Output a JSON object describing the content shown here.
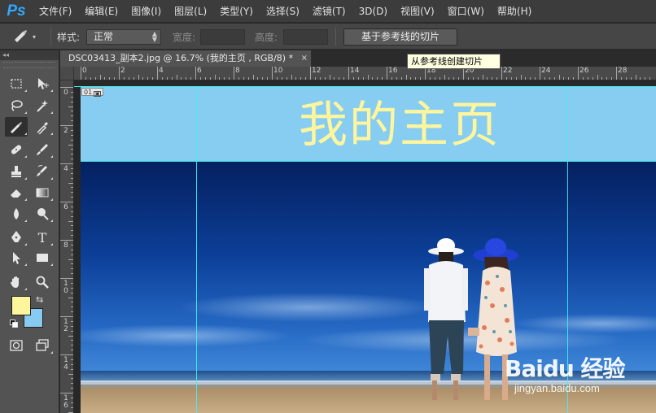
{
  "app": {
    "logo": "Ps"
  },
  "menu": [
    "文件(F)",
    "编辑(E)",
    "图像(I)",
    "图层(L)",
    "类型(Y)",
    "选择(S)",
    "滤镜(T)",
    "3D(D)",
    "视图(V)",
    "窗口(W)",
    "帮助(H)"
  ],
  "options": {
    "style_label": "样式:",
    "style_value": "正常",
    "width_label": "宽度:",
    "width_value": "",
    "height_label": "高度:",
    "height_value": "",
    "slice_button": "基于参考线的切片"
  },
  "tooltip": "从参考线创建切片",
  "document": {
    "tab_title": "DSC03413_副本2.jpg @ 16.7% (我的主页 , RGB/8) *",
    "close_glyph": "×"
  },
  "ruler": {
    "h_labels": [
      "0",
      "2",
      "4",
      "6",
      "8",
      "10",
      "12",
      "14",
      "16",
      "18",
      "20",
      "22",
      "24",
      "26",
      "28"
    ],
    "v_labels": [
      "0",
      "2",
      "4",
      "6",
      "8",
      "1\n0",
      "1\n2",
      "1\n4",
      "1\n6"
    ]
  },
  "canvas": {
    "banner_text": "我的主页",
    "slice_number": "01",
    "banner_color": "#87cdf2",
    "banner_text_color": "#fff59d"
  },
  "colors": {
    "foreground": "#fff59d",
    "background": "#87cbf0",
    "guide": "#3ff2f2",
    "ps_blue": "#31a8ff"
  },
  "tools": [
    "rectangular-marquee-icon",
    "move-icon",
    "lasso-icon",
    "magic-wand-icon",
    "slice-icon",
    "eyedropper-icon",
    "healing-brush-icon",
    "brush-icon",
    "clone-stamp-icon",
    "history-brush-icon",
    "eraser-icon",
    "gradient-icon",
    "blur-icon",
    "dodge-icon",
    "pen-icon",
    "type-icon",
    "path-selection-icon",
    "rectangle-shape-icon",
    "hand-icon",
    "zoom-icon",
    "quick-mask-icon",
    "screen-mode-icon"
  ],
  "watermark": {
    "text": "Baidu 经验",
    "sub": "jingyan.baidu.com"
  }
}
